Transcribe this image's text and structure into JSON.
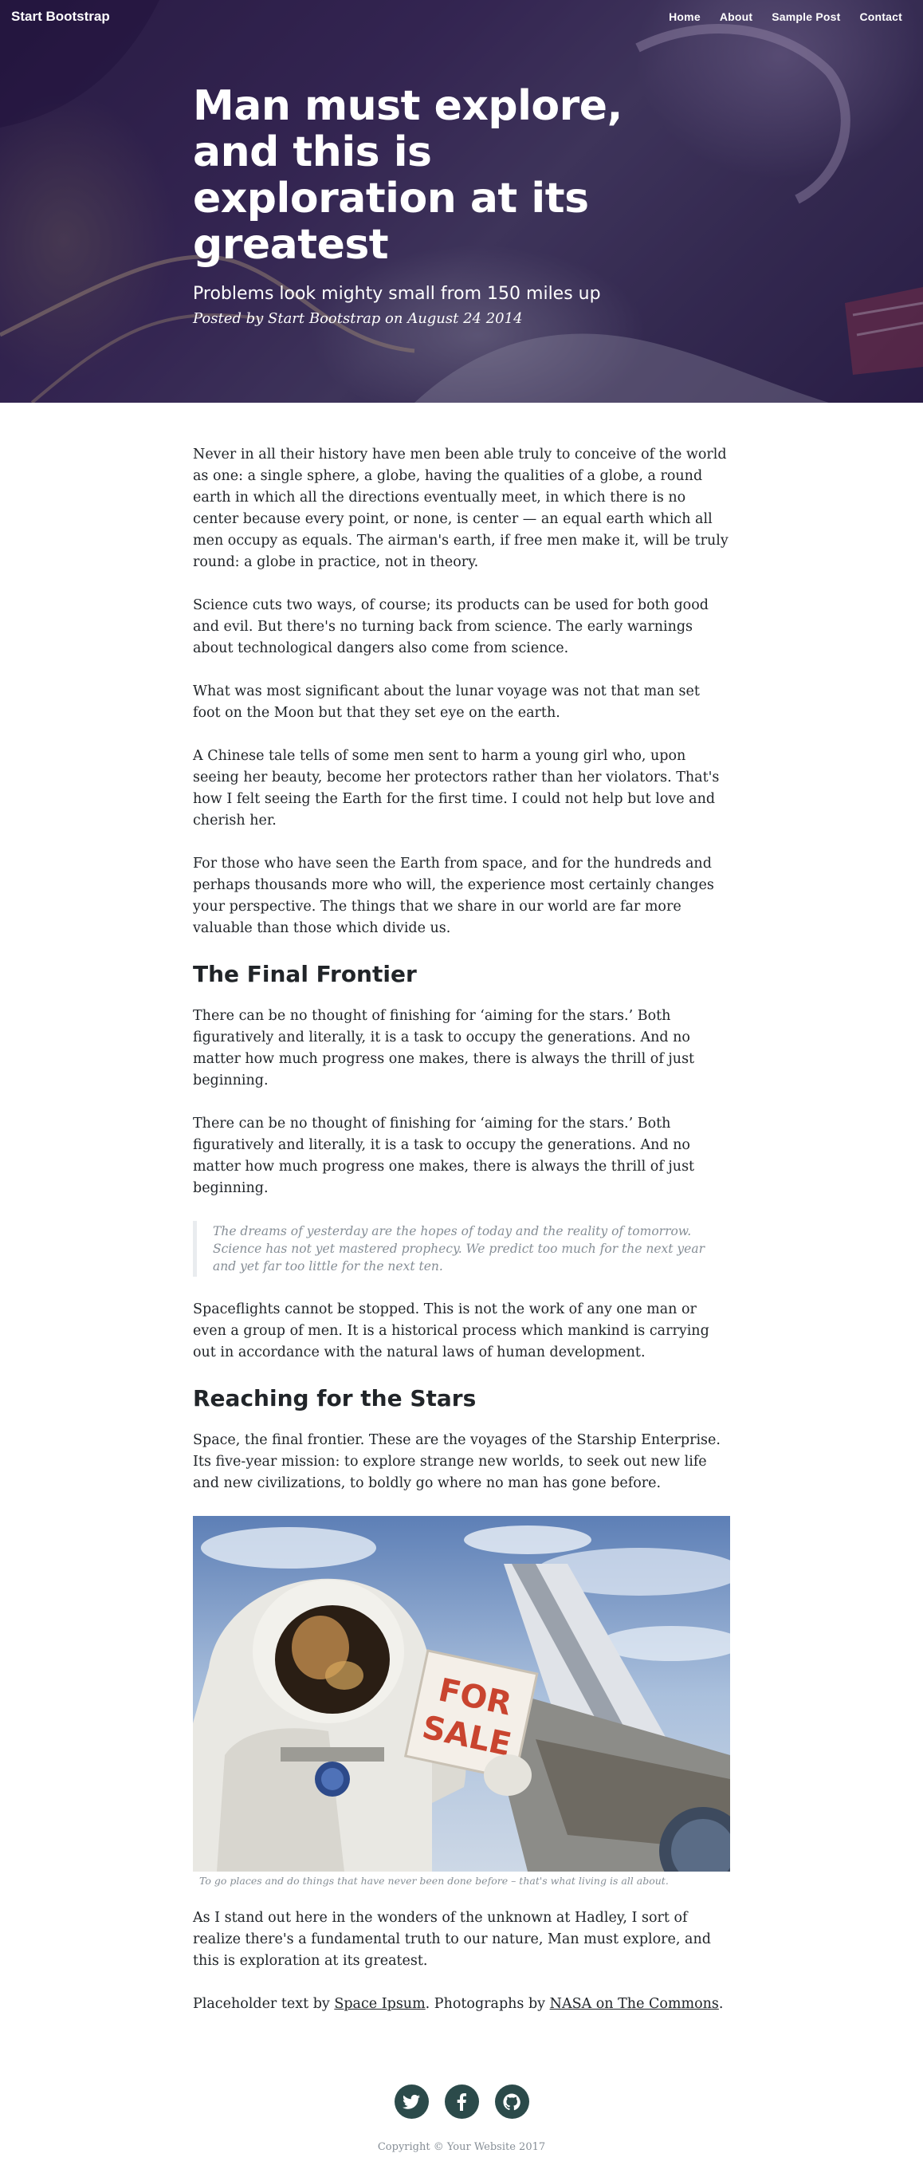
{
  "nav": {
    "brand": "Start Bootstrap",
    "links": [
      "Home",
      "About",
      "Sample Post",
      "Contact"
    ]
  },
  "header": {
    "title": "Man must explore, and this is exploration at its greatest",
    "subtitle": "Problems look mighty small from 150 miles up",
    "meta": "Posted by Start Bootstrap on August 24 2014"
  },
  "article": {
    "p1": "Never in all their history have men been able truly to conceive of the world as one: a single sphere, a globe, having the qualities of a globe, a round earth in which all the directions eventually meet, in which there is no center because every point, or none, is center — an equal earth which all men occupy as equals. The airman's earth, if free men make it, will be truly round: a globe in practice, not in theory.",
    "p2": "Science cuts two ways, of course; its products can be used for both good and evil. But there's no turning back from science. The early warnings about technological dangers also come from science.",
    "p3": "What was most significant about the lunar voyage was not that man set foot on the Moon but that they set eye on the earth.",
    "p4": "A Chinese tale tells of some men sent to harm a young girl who, upon seeing her beauty, become her protectors rather than her violators. That's how I felt seeing the Earth for the first time. I could not help but love and cherish her.",
    "p5": "For those who have seen the Earth from space, and for the hundreds and perhaps thousands more who will, the experience most certainly changes your perspective. The things that we share in our world are far more valuable than those which divide us.",
    "h2_1": "The Final Frontier",
    "p6": "There can be no thought of finishing for ‘aiming for the stars.’ Both figuratively and literally, it is a task to occupy the generations. And no matter how much progress one makes, there is always the thrill of just beginning.",
    "p7": "There can be no thought of finishing for ‘aiming for the stars.’ Both figuratively and literally, it is a task to occupy the generations. And no matter how much progress one makes, there is always the thrill of just beginning.",
    "quote": "The dreams of yesterday are the hopes of today and the reality of tomorrow. Science has not yet mastered prophecy. We predict too much for the next year and yet far too little for the next ten.",
    "p8": "Spaceflights cannot be stopped. This is not the work of any one man or even a group of men. It is a historical process which mankind is carrying out in accordance with the natural laws of human development.",
    "h2_2": "Reaching for the Stars",
    "p9": "Space, the final frontier. These are the voyages of the Starship Enterprise. Its five-year mission: to explore strange new worlds, to seek out new life and new civilizations, to boldly go where no man has gone before.",
    "sign_text_1": "FOR",
    "sign_text_2": "SALE",
    "caption": "To go places and do things that have never been done before – that's what living is all about.",
    "p10": "As I stand out here in the wonders of the unknown at Hadley, I sort of realize there's a fundamental truth to our nature, Man must explore, and this is exploration at its greatest.",
    "credit_prefix": "Placeholder text by ",
    "credit_link1": "Space Ipsum",
    "credit_mid": ". Photographs by ",
    "credit_link2": "NASA on The Commons",
    "credit_suffix": "."
  },
  "footer": {
    "icons": [
      "twitter-icon",
      "facebook-icon",
      "github-icon"
    ],
    "copyright": "Copyright © Your Website 2017",
    "icon_bg": "#2b4a4a"
  }
}
